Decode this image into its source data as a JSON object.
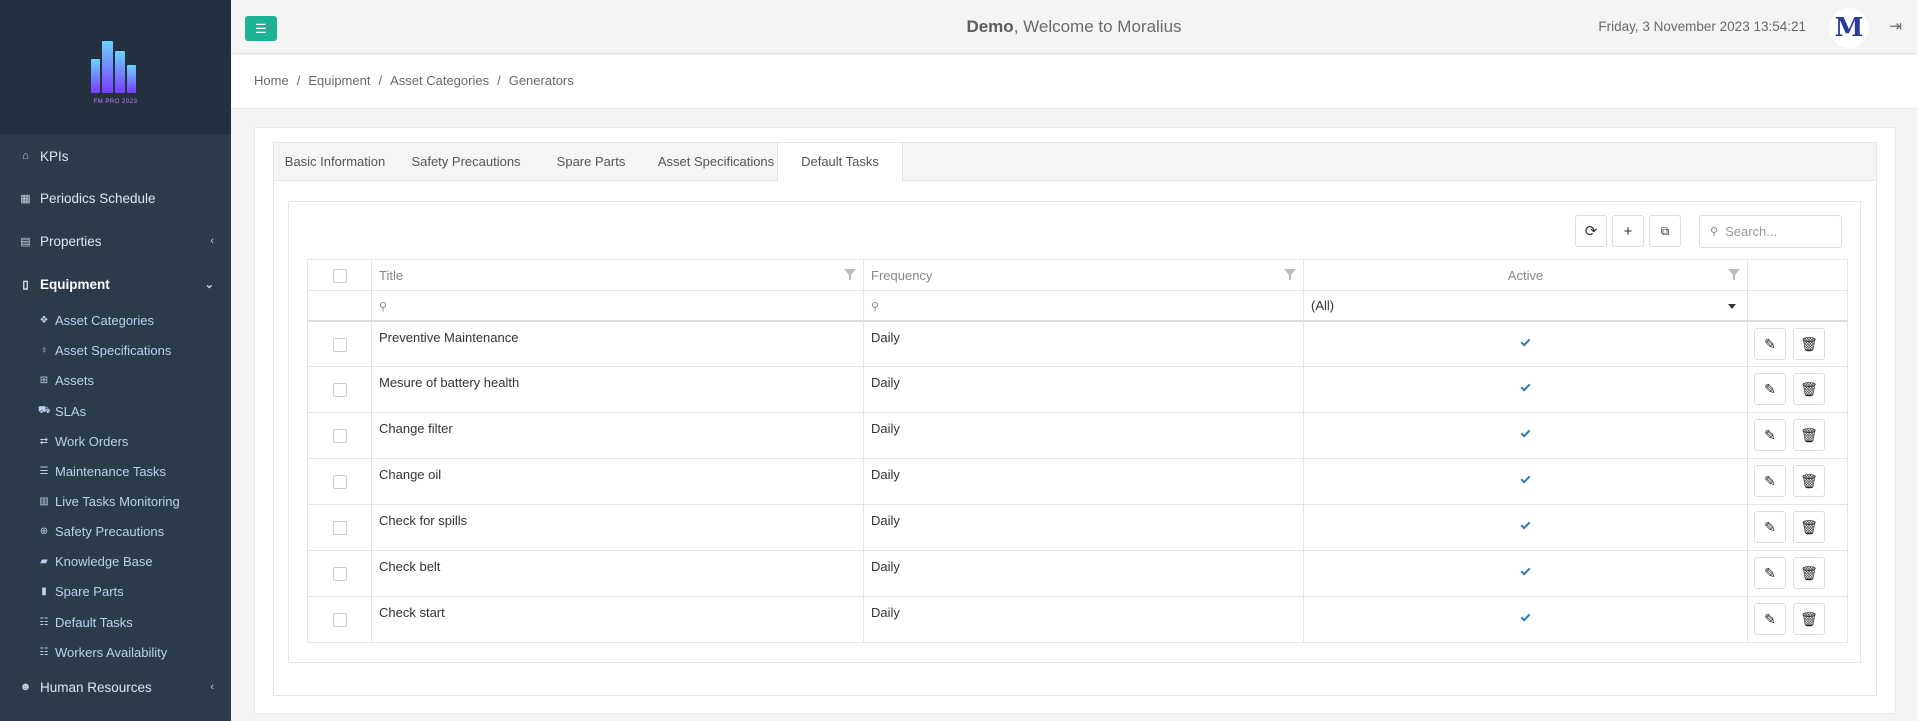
{
  "sidebar": {
    "logo_text": "FM PRO 2023",
    "items": [
      {
        "label": "KPIs",
        "icon": "home-icon"
      },
      {
        "label": "Periodics Schedule",
        "icon": "calendar-icon"
      },
      {
        "label": "Properties",
        "icon": "building-icon"
      },
      {
        "label": "Equipment",
        "icon": "equipment-icon"
      },
      {
        "label": "Human Resources",
        "icon": "users-icon"
      }
    ],
    "equipment_subitems": [
      {
        "label": "Asset Categories",
        "icon": "cubes-icon"
      },
      {
        "label": "Asset Specifications",
        "icon": "lightbulb-icon"
      },
      {
        "label": "Assets",
        "icon": "grid-icon"
      },
      {
        "label": "SLAs",
        "icon": "truck-icon"
      },
      {
        "label": "Work Orders",
        "icon": "exchange-icon"
      },
      {
        "label": "Maintenance Tasks",
        "icon": "list-icon"
      },
      {
        "label": "Live Tasks Monitoring",
        "icon": "map-icon"
      },
      {
        "label": "Safety Precautions",
        "icon": "medkit-icon"
      },
      {
        "label": "Knowledge Base",
        "icon": "book-icon"
      },
      {
        "label": "Spare Parts",
        "icon": "database-icon"
      },
      {
        "label": "Default Tasks",
        "icon": "list-ol-icon"
      },
      {
        "label": "Workers Availability",
        "icon": "list-ol-icon"
      }
    ]
  },
  "topbar": {
    "user": "Demo",
    "welcome_suffix": ", Welcome to Moralius",
    "datetime": "Friday, 3 November 2023 13:54:21",
    "avatar_letter": "M"
  },
  "breadcrumb": [
    "Home",
    "Equipment",
    "Asset Categories",
    "Generators"
  ],
  "tabs": [
    "Basic Information",
    "Safety Precautions",
    "Spare Parts",
    "Asset Specifications",
    "Default Tasks"
  ],
  "active_tab": "Default Tasks",
  "grid": {
    "search_placeholder": "Search...",
    "columns": [
      "Title",
      "Frequency",
      "Active"
    ],
    "active_filter_value": "(All)",
    "rows": [
      {
        "title": "Preventive Maintenance",
        "frequency": "Daily",
        "active": true
      },
      {
        "title": "Mesure of battery health",
        "frequency": "Daily",
        "active": true
      },
      {
        "title": "Change filter",
        "frequency": "Daily",
        "active": true
      },
      {
        "title": "Change oil",
        "frequency": "Daily",
        "active": true
      },
      {
        "title": "Check for spills",
        "frequency": "Daily",
        "active": true
      },
      {
        "title": "Check belt",
        "frequency": "Daily",
        "active": true
      },
      {
        "title": "Check start",
        "frequency": "Daily",
        "active": true
      }
    ]
  },
  "colors": {
    "sidebar_bg": "#2c3b4a",
    "accent": "#1cb394",
    "check": "#337ab7"
  }
}
